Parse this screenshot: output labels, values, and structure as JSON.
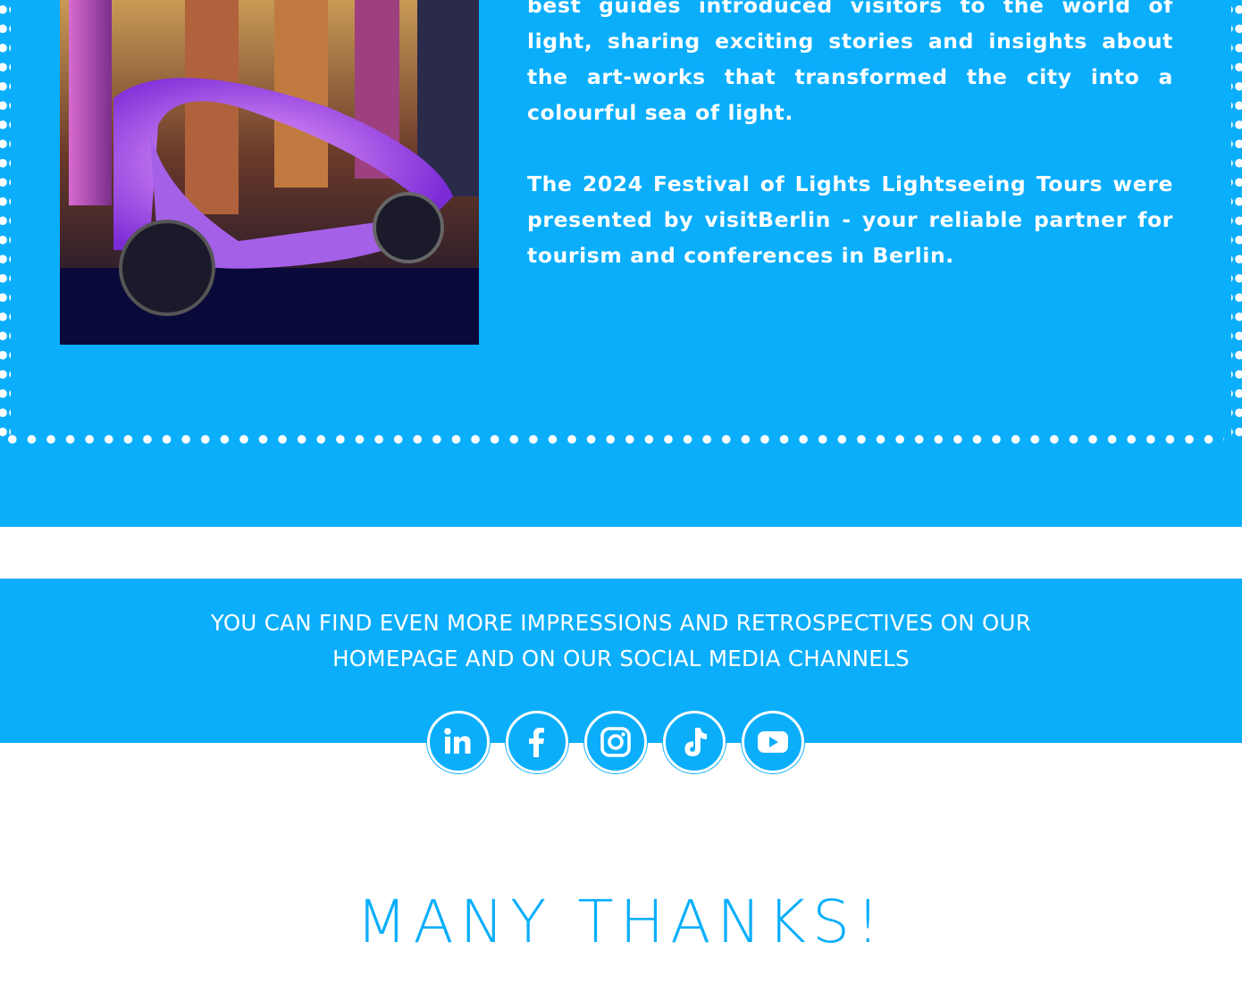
{
  "feature": {
    "photo_alt": "",
    "paragraphs": [
      "best guides introduced visitors to the world of light, sharing exciting stories and insights about the art-works that transformed the city into a colourful sea of light.",
      "The 2024 Festival of Lights Lightseeing Tours were presented by visitBerlin - your reliable partner for tourism and conferences in Berlin."
    ]
  },
  "social": {
    "text": "YOU CAN FIND EVEN MORE IMPRESSIONS AND RETROSPECTIVES ON OUR HOMEPAGE AND ON OUR SOCIAL MEDIA CHANNELS",
    "icons": [
      "linkedin-icon",
      "facebook-icon",
      "instagram-icon",
      "tiktok-icon",
      "youtube-icon"
    ]
  },
  "closing": {
    "title": "MANY THANKS!"
  },
  "colors": {
    "accent": "#0aaefb",
    "white": "#ffffff"
  }
}
